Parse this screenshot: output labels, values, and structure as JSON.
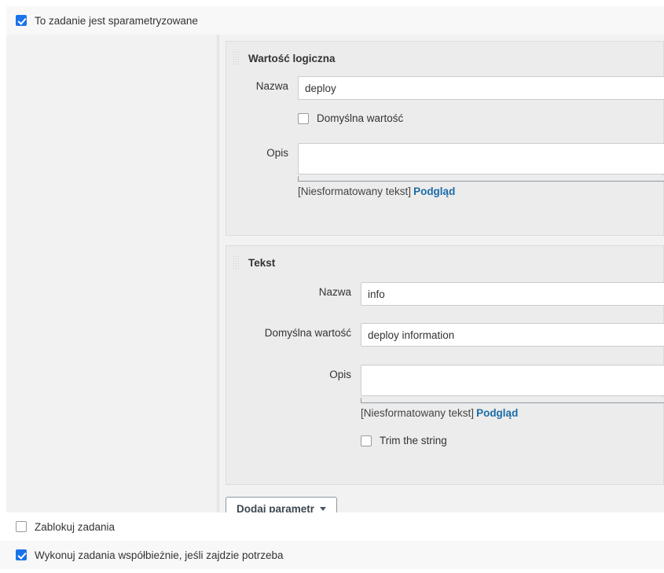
{
  "header": {
    "parameterized_label": "To zadanie jest sparametryzowane",
    "parameterized_checked": true
  },
  "parameters": [
    {
      "type_title": "Wartość logiczna",
      "drag_handle_icon": "drag-handle-icon",
      "name_label": "Nazwa",
      "name_value": "deploy",
      "default_checkbox_label": "Domyślna wartość",
      "default_checkbox_checked": false,
      "description_label": "Opis",
      "description_value": "",
      "markup_hint": "[Niesformatowany tekst]",
      "preview_link": "Podgląd"
    },
    {
      "type_title": "Tekst",
      "drag_handle_icon": "drag-handle-icon",
      "name_label": "Nazwa",
      "name_value": "info",
      "default_label": "Domyślna wartość",
      "default_value": "deploy information",
      "description_label": "Opis",
      "description_value": "",
      "markup_hint": "[Niesformatowany tekst]",
      "preview_link": "Podgląd",
      "trim_label": "Trim the string",
      "trim_checked": false
    }
  ],
  "add_parameter": {
    "label": "Dodaj parametr",
    "caret_icon": "chevron-down-icon"
  },
  "bottom": {
    "block_label": "Zablokuj zadania",
    "block_checked": false,
    "concurrent_label": "Wykonuj zadania współbieżnie, jeśli zajdzie potrzeba",
    "concurrent_checked": true
  },
  "colors": {
    "accent": "#1a73e8",
    "link": "#1b6ca8",
    "panel": "#ececec",
    "body": "#f2f2f2",
    "header_band": "#f8f8f8"
  }
}
